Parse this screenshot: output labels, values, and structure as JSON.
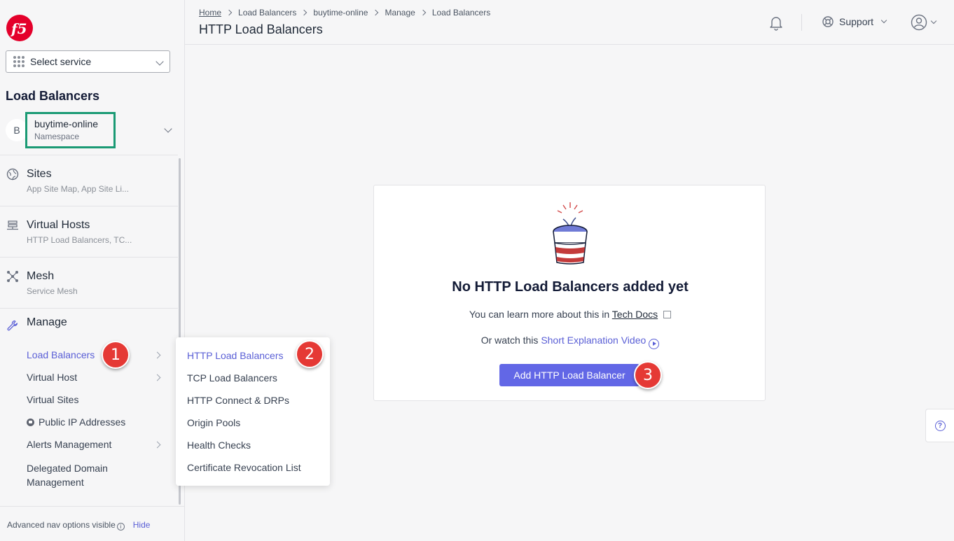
{
  "sidebar": {
    "service_select": {
      "label": "Select service"
    },
    "section_title": "Load Balancers",
    "namespace": {
      "avatar": "B",
      "name": "buytime-online",
      "label": "Namespace"
    },
    "nav": [
      {
        "title": "Sites",
        "sub": "App Site Map, App Site Li...",
        "icon": "globe-icon"
      },
      {
        "title": "Virtual Hosts",
        "sub": "HTTP Load Balancers, TC...",
        "icon": "server-stack-icon"
      },
      {
        "title": "Mesh",
        "sub": "Service Mesh",
        "icon": "mesh-icon"
      }
    ],
    "manage": {
      "title": "Manage",
      "items": [
        {
          "label": "Load Balancers",
          "has_submenu": true,
          "active": true
        },
        {
          "label": "Virtual Host",
          "has_submenu": true
        },
        {
          "label": "Virtual Sites",
          "has_submenu": false
        },
        {
          "label": "Public IP Addresses",
          "has_submenu": false,
          "locked": true
        },
        {
          "label": "Alerts Management",
          "has_submenu": true
        },
        {
          "label": "Delegated Domain Management",
          "has_submenu": false
        }
      ]
    },
    "footer": {
      "text": "Advanced nav options visible",
      "hide_label": "Hide"
    }
  },
  "flyout": {
    "items": [
      "HTTP Load Balancers",
      "TCP Load Balancers",
      "HTTP Connect & DRPs",
      "Origin Pools",
      "Health Checks",
      "Certificate Revocation List"
    ]
  },
  "callouts": [
    "1",
    "2",
    "3"
  ],
  "header": {
    "breadcrumb": [
      "Home",
      "Load Balancers",
      "buytime-online",
      "Manage",
      "Load Balancers"
    ],
    "title": "HTTP Load Balancers",
    "support_label": "Support"
  },
  "empty_state": {
    "title": "No HTTP Load Balancers added yet",
    "line1_prefix": "You can learn more about this in",
    "line1_link": "Tech Docs",
    "line2_prefix": "Or watch this",
    "line2_link": "Short Explanation Video",
    "button": "Add HTTP Load Balancer"
  },
  "colors": {
    "accent": "#6267e6",
    "namespace_highlight": "#1a9a74",
    "callout": "#e53935",
    "brand": "#e4002b"
  }
}
